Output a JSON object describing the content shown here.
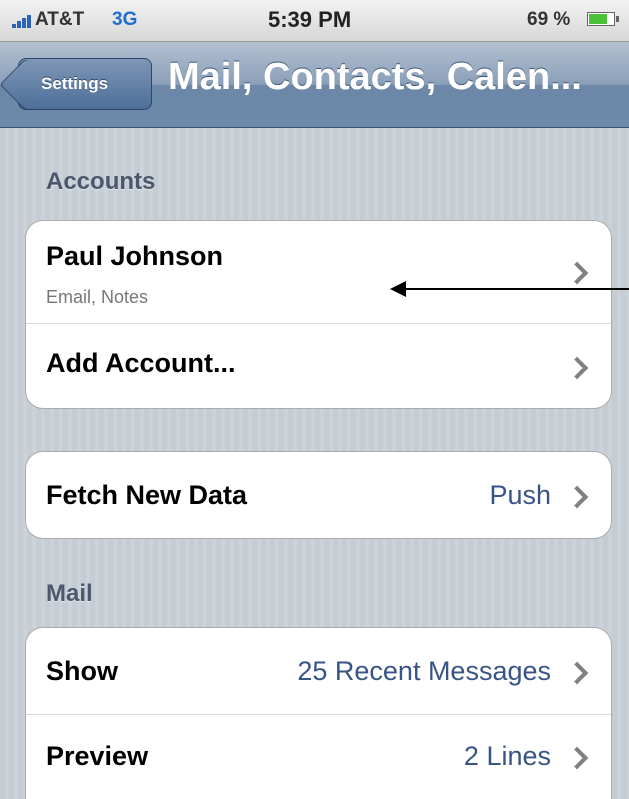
{
  "status_bar": {
    "carrier": "AT&T",
    "network": "3G",
    "time": "5:39 PM",
    "battery": "69 %"
  },
  "nav": {
    "back_label": "Settings",
    "title": "Mail, Contacts, Calen..."
  },
  "accounts_section": {
    "header": "Accounts",
    "rows": [
      {
        "title": "Paul Johnson",
        "subtitle": "Email, Notes"
      },
      {
        "title": "Add Account..."
      }
    ]
  },
  "fetch_group": {
    "rows": [
      {
        "title": "Fetch New Data",
        "value": "Push"
      }
    ]
  },
  "mail_section": {
    "header": "Mail",
    "rows": [
      {
        "title": "Show",
        "value": "25 Recent Messages"
      },
      {
        "title": "Preview",
        "value": "2 Lines"
      }
    ]
  },
  "colors": {
    "nav_blue": "#6d89aa",
    "value_blue": "#385487",
    "section_text": "#4c566c",
    "battery_green": "#4bc039"
  },
  "icons": {
    "signal": "signal-bars-icon",
    "battery": "battery-icon",
    "chevron": "chevron-right-icon",
    "annotation": "annotation-arrow"
  }
}
